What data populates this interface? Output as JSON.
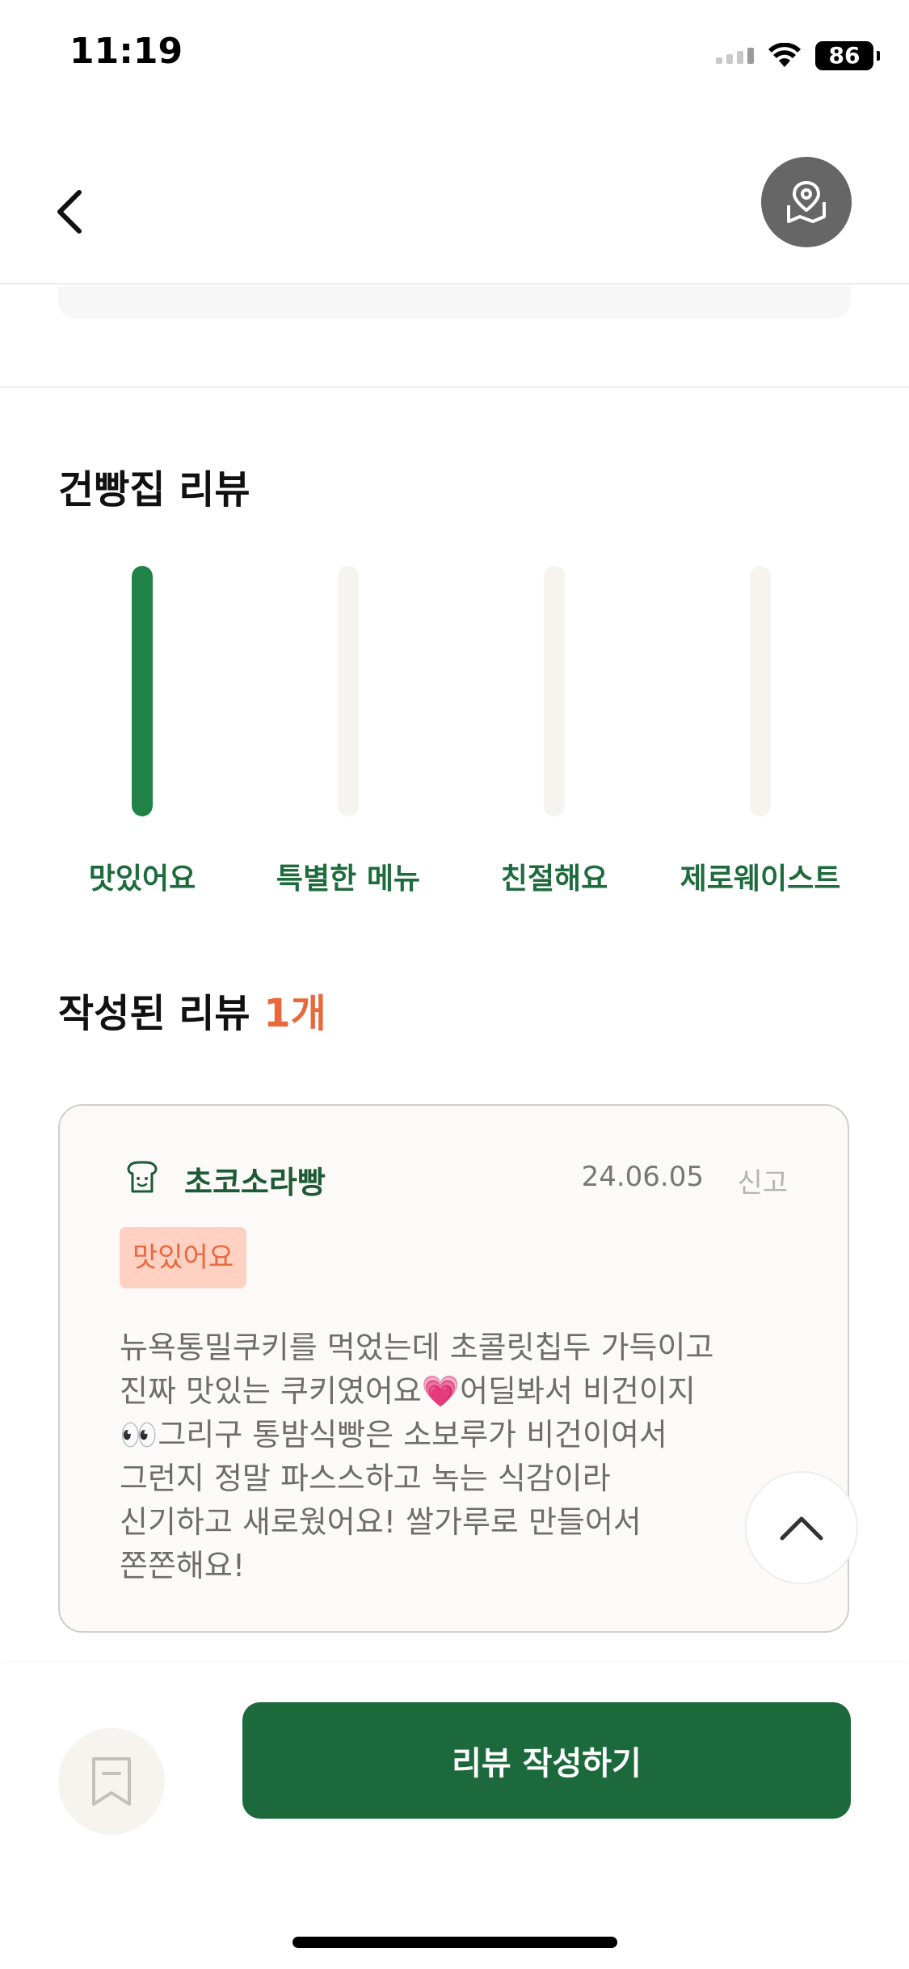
{
  "status_bar": {
    "time": "11:19",
    "battery": "86"
  },
  "review_section": {
    "title": "건빵집 리뷰",
    "categories": [
      {
        "label": "맛있어요",
        "value": 1
      },
      {
        "label": "특별한 메뉴",
        "value": 0
      },
      {
        "label": "친절해요",
        "value": 0
      },
      {
        "label": "제로웨이스트",
        "value": 0
      }
    ]
  },
  "written_reviews": {
    "title": "작성된 리뷰",
    "count": "1개"
  },
  "review": {
    "author": "초코소라빵",
    "date": "24.06.05",
    "report_label": "신고",
    "tag": "맛있어요",
    "lines": [
      "뉴욕통밀쿠키를 먹었는데 초콜릿칩두 가득이고",
      "진짜 맛있는 쿠키였어요💗어딜봐서 비건이지",
      "👀그리구 통밤식빵은 소보루가 비건이여서",
      "그런지 정말 파스스하고 녹는 식감이라",
      "신기하고 새로웠어요! 쌀가루로 만들어서",
      "쫀쫀해요!"
    ]
  },
  "bottom_bar": {
    "write_review_label": "리뷰 작성하기"
  },
  "colors": {
    "brand_green": "#1c6a3c",
    "bar_fill": "#218247",
    "accent_orange": "#e8693b"
  }
}
